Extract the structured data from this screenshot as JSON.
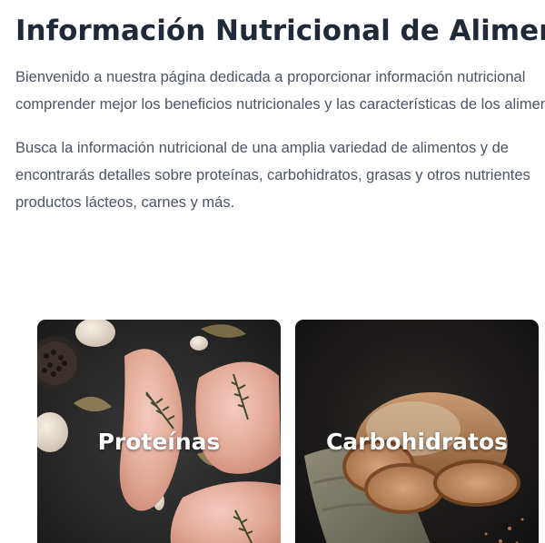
{
  "page": {
    "title": "Información Nutricional de Alimentos",
    "intro_lines": [
      "Bienvenido a nuestra página dedicada a proporcionar información nutricional",
      "comprender mejor los beneficios nutricionales y las características de los alimentos"
    ],
    "search_lines": [
      "Busca la información nutricional de una amplia variedad de alimentos y de",
      "encontrarás detalles sobre proteínas, carbohidratos, grasas y otros nutrientes",
      "productos lácteos, carnes y más."
    ]
  },
  "cards": [
    {
      "title": "Proteínas",
      "image": "raw-chicken-breast-photo"
    },
    {
      "title": "Carbohidratos",
      "image": "bread-loaf-photo"
    }
  ],
  "colors": {
    "heading": "#1f2937",
    "body_text": "#4b5563",
    "card_title": "#ffffff"
  }
}
